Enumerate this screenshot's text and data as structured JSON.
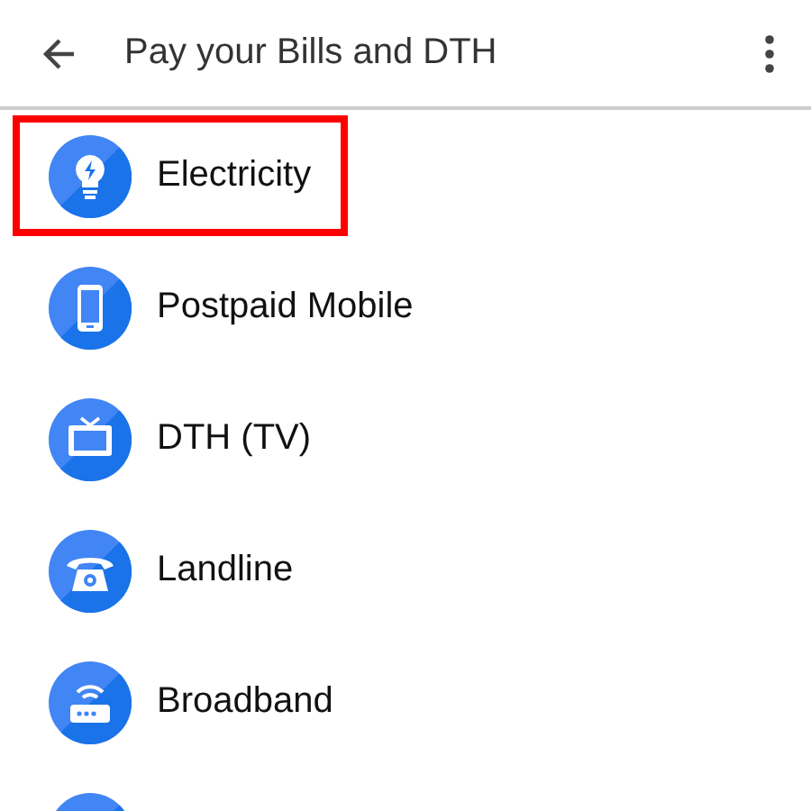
{
  "app_bar": {
    "title": "Pay your Bills and DTH"
  },
  "items": [
    {
      "kind": "bulb",
      "label": "Electricity",
      "highlighted": true
    },
    {
      "kind": "phone",
      "label": "Postpaid Mobile",
      "highlighted": false
    },
    {
      "kind": "tv",
      "label": "DTH (TV)",
      "highlighted": false
    },
    {
      "kind": "telephone",
      "label": "Landline",
      "highlighted": false
    },
    {
      "kind": "router",
      "label": "Broadband",
      "highlighted": false
    },
    {
      "kind": "partial",
      "highlighted": false
    }
  ]
}
